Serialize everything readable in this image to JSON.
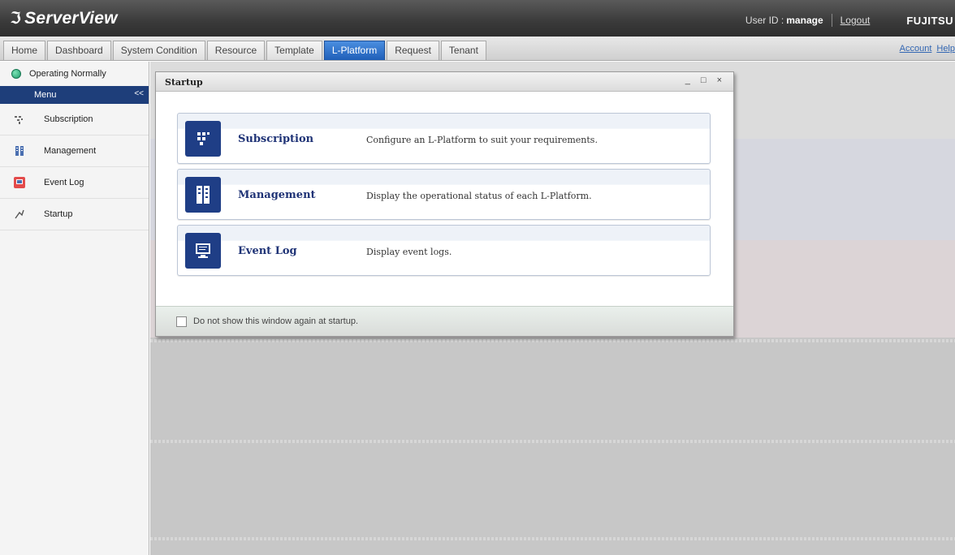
{
  "header": {
    "logo_text": "ServerView",
    "user_label": "User ID :",
    "user_id": "manage",
    "logout": "Logout",
    "brand": "FUJITSU"
  },
  "tabs": [
    {
      "label": "Home",
      "active": false
    },
    {
      "label": "Dashboard",
      "active": false
    },
    {
      "label": "System Condition",
      "active": false
    },
    {
      "label": "Resource",
      "active": false
    },
    {
      "label": "Template",
      "active": false
    },
    {
      "label": "L-Platform",
      "active": true
    },
    {
      "label": "Request",
      "active": false
    },
    {
      "label": "Tenant",
      "active": false
    }
  ],
  "top_links": {
    "account": "Account",
    "help": "Help"
  },
  "sidebar": {
    "status": "Operating Normally",
    "status_color": "#1e9a6a",
    "menu_title": "Menu",
    "collapse": "<<",
    "items": [
      {
        "label": "Subscription",
        "icon": "subscription-icon"
      },
      {
        "label": "Management",
        "icon": "management-icon"
      },
      {
        "label": "Event Log",
        "icon": "event-log-icon"
      },
      {
        "label": "Startup",
        "icon": "startup-icon"
      }
    ]
  },
  "dialog": {
    "title": "Startup",
    "minimize": "_",
    "maximize": "□",
    "close": "×",
    "cards": [
      {
        "name": "Subscription",
        "desc": "Configure an L-Platform to suit your requirements.",
        "icon": "subscription-icon"
      },
      {
        "name": "Management",
        "desc": "Display the operational status of each L-Platform.",
        "icon": "management-icon"
      },
      {
        "name": "Event Log",
        "desc": "Display event logs.",
        "icon": "event-log-icon"
      }
    ],
    "checkbox_label": "Do not show this window again at startup."
  },
  "colors": {
    "accent": "#1f3e86",
    "active_tab": "#1f5fb8",
    "menu_header": "#1e3e7a"
  }
}
